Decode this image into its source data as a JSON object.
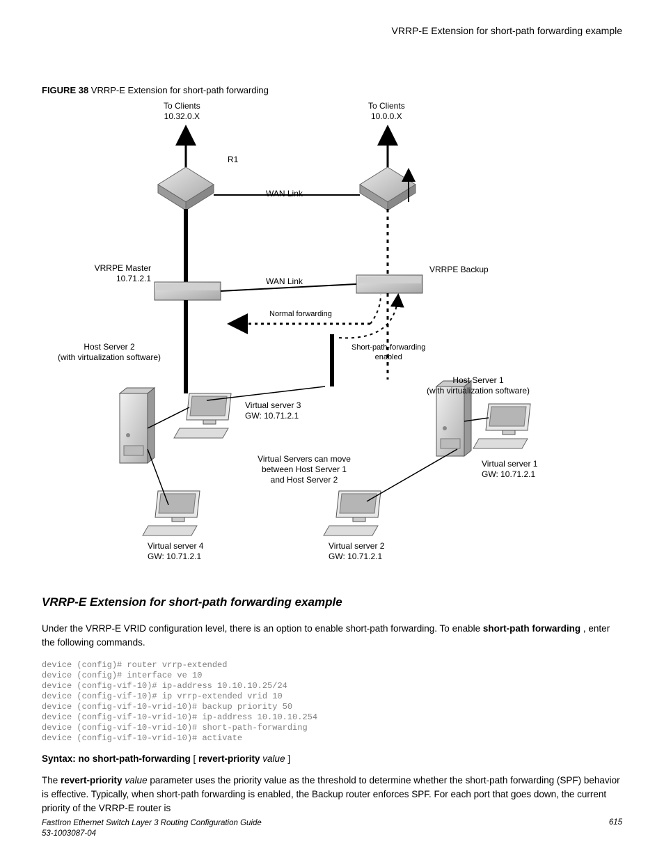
{
  "header": {
    "running_title": "VRRP-E Extension for short-path forwarding example"
  },
  "figure": {
    "caption_label": "FIGURE 38 ",
    "caption_text": "VRRP-E Extension for short-path forwarding",
    "labels": {
      "to_clients_left_1": "To Clients",
      "to_clients_left_2": "10.32.0.X",
      "to_clients_right_1": "To Clients",
      "to_clients_right_2": "10.0.0.X",
      "r1": "R1",
      "wan_link_top": "WAN Link",
      "vrrpe_master_1": "VRRPE Master",
      "vrrpe_master_2": "10.71.2.1",
      "vrrpe_backup": "VRRPE Backup",
      "wan_link_mid": "WAN Link",
      "normal_fwd": "Normal forwarding",
      "spf_enabled_1": "Short-path-forwarding",
      "spf_enabled_2": "enabled",
      "host2_1": "Host Server 2",
      "host2_2": "(with virtualization software)",
      "host1_1": "Host Server 1",
      "host1_2": "(with virtualization software)",
      "vs3_1": "Virtual server 3",
      "vs3_2": "GW: 10.71.2.1",
      "move_1": "Virtual Servers can move",
      "move_2": "between Host Server 1",
      "move_3": "and Host Server 2",
      "vs1_1": "Virtual server 1",
      "vs1_2": "GW: 10.71.2.1",
      "vs4_1": "Virtual server 4",
      "vs4_2": "GW: 10.71.2.1",
      "vs2_1": "Virtual server 2",
      "vs2_2": "GW: 10.71.2.1"
    }
  },
  "section": {
    "heading": "VRRP-E Extension for short-path forwarding example",
    "para1_a": "Under the VRRP-E VRID configuration level, there is an option to enable short-path forwarding. To enable ",
    "para1_b_bold": "short-path forwarding",
    "para1_c": " , enter the following commands.",
    "code": "device (config)# router vrrp-extended\ndevice (config)# interface ve 10\ndevice (config-vif-10)# ip-address 10.10.10.25/24\ndevice (config-vif-10)# ip vrrp-extended vrid 10\ndevice (config-vif-10-vrid-10)# backup priority 50\ndevice (config-vif-10-vrid-10)# ip-address 10.10.10.254\ndevice (config-vif-10-vrid-10)# short-path-forwarding\ndevice (config-vif-10-vrid-10)# activate",
    "syntax_prefix_bold": "Syntax: no short-path-forwarding",
    "syntax_bracket_open": " [ ",
    "syntax_mid_bold": "revert-priority",
    "syntax_value_italic": " value",
    "syntax_bracket_close": " ]",
    "para2_a": "The ",
    "para2_b_bold": "revert-priority",
    "para2_c_italic": " value",
    "para2_d": " parameter uses the priority value as the threshold to determine whether the short-path forwarding (SPF) behavior is effective. Typically, when short-path forwarding is enabled, the Backup router enforces SPF. For each port that goes down, the current priority of the VRRP-E router is"
  },
  "footer": {
    "line1": "FastIron Ethernet Switch Layer 3 Routing Configuration Guide",
    "line2": "53-1003087-04",
    "page": "615"
  }
}
